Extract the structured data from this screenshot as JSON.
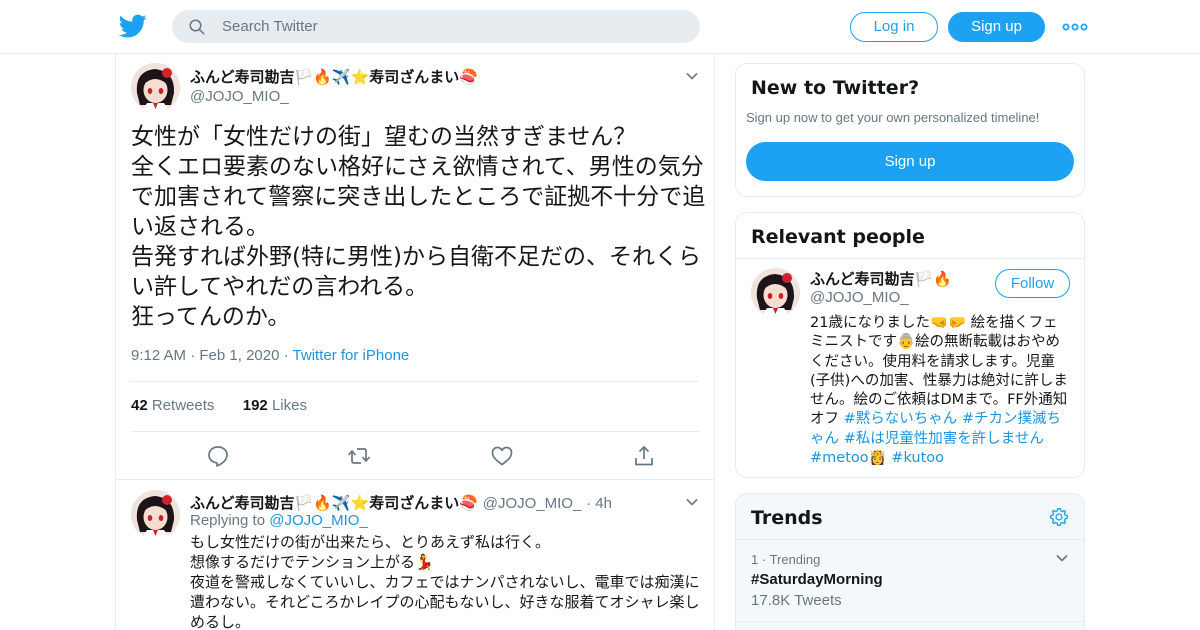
{
  "header": {
    "search_placeholder": "Search Twitter",
    "login_label": "Log in",
    "signup_label": "Sign up",
    "brand_color": "#1da1f2"
  },
  "tweet": {
    "author_name": "ふんど寿司勘吉🏳️🔥✈️⭐寿司ざんまい🍣",
    "author_handle": "@JOJO_MIO_",
    "text": "女性が「女性だけの街」望むの当然すぎません？\n全くエロ要素のない格好にさえ欲情されて、男性の気分で加害されて警察に突き出したところで証拠不十分で追い返される。\n告発すれば外野(特に男性)から自衛不足だの、それくらい許してやれだの言われる。\n狂ってんのか。",
    "time": "9:12 AM",
    "date": "Feb 1, 2020",
    "source": "Twitter for iPhone",
    "retweets_count": "42",
    "retweets_label": "Retweets",
    "likes_count": "192",
    "likes_label": "Likes"
  },
  "reply": {
    "author_name": "ふんど寿司勘吉🏳️🔥✈️⭐寿司ざんまい🍣",
    "author_handle": "@JOJO_MIO_",
    "age": "4h",
    "replying_prefix": "Replying to",
    "replying_to": "@JOJO_MIO_",
    "text": "もし女性だけの街が出来たら、とりあえず私は行く。\n想像するだけでテンション上がる💃\n夜道を警戒しなくていいし、カフェではナンパされないし、電車では痴漢に遭わない。それどころかレイプの心配もないし、好きな服着てオシャレ楽しめるし。"
  },
  "sidebar": {
    "new": {
      "title": "New to Twitter?",
      "subtitle": "Sign up now to get your own personalized timeline!",
      "button": "Sign up"
    },
    "people": {
      "title": "Relevant people",
      "name": "ふんど寿司勘吉🏳️🔥",
      "handle": "@JOJO_MIO_",
      "follow_label": "Follow",
      "bio_text": "21歳になりました🤜🤛 絵を描くフェミニストです👵絵の無断転載はおやめください。使用料を請求します。児童(子供)への加害、性暴力は絶対に許しません。絵のご依頼はDMまで。FF外通知オフ ",
      "bio_tag1": "#黙らないちゃん",
      "bio_tag2": "#チカン撲滅ちゃん",
      "bio_tag3": "#私は児童性加害を許しません",
      "bio_tag4": "#metoo",
      "bio_emoji": "👸",
      "bio_tag5": "#kutoo"
    },
    "trends": {
      "title": "Trends",
      "item_rank": "1",
      "item_label": "Trending",
      "item_name": "#SaturdayMorning",
      "item_count": "17.8K Tweets"
    }
  }
}
